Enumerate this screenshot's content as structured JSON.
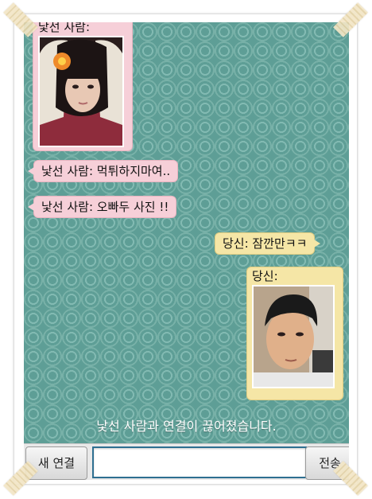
{
  "chat": {
    "stranger_photo_label": "낯선 사람:",
    "stranger_msg_1": "낯선 사람: 먹튀하지마여..",
    "stranger_msg_2": "낯선 사람: 오빠두 사진 !!",
    "me_msg_1": "당신: 잠깐만ㅋㅋ",
    "me_photo_label": "당신:"
  },
  "status": {
    "disconnected": "낯선 사람과 연결이 끊어졌습니다."
  },
  "bottom_bar": {
    "new_connection_label": "새 연결",
    "message_value": "",
    "send_label": "전송"
  },
  "colors": {
    "stranger_bubble": "#f6cfd8",
    "my_bubble": "#f5e6a6",
    "background": "#5e9e96",
    "input_border": "#2e6f91"
  }
}
